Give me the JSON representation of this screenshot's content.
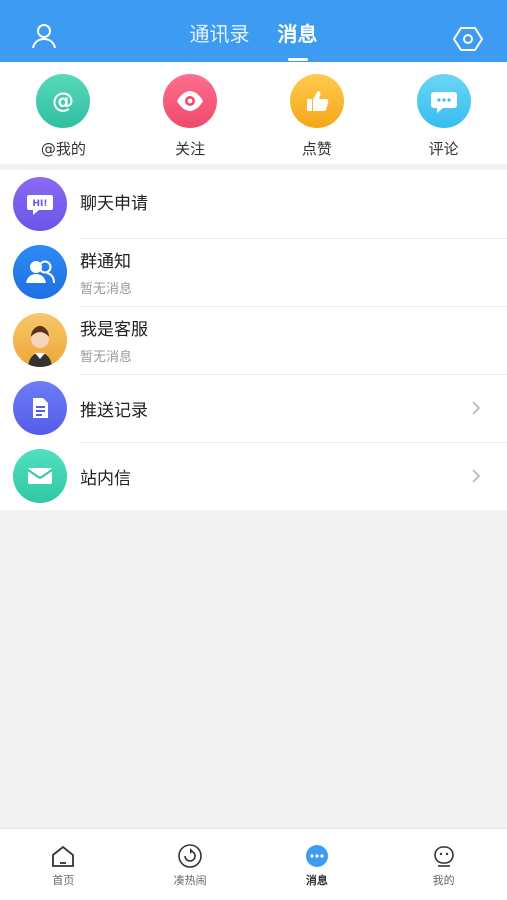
{
  "header": {
    "tabs": [
      {
        "label": "通讯录",
        "active": false
      },
      {
        "label": "消息",
        "active": true
      }
    ],
    "left_icon": "user-icon",
    "right_icon": "settings-hex-icon",
    "bg_color": "#3d9bf1"
  },
  "quick_actions": [
    {
      "label": "@我的",
      "icon": "at-icon",
      "color": "#3dcfae"
    },
    {
      "label": "关注",
      "icon": "eye-icon",
      "color": "#f25b7d"
    },
    {
      "label": "点赞",
      "icon": "thumbs-up-icon",
      "color": "#f5b22e"
    },
    {
      "label": "评论",
      "icon": "comment-icon",
      "color": "#45c7f2"
    }
  ],
  "messages": [
    {
      "title": "聊天申请",
      "subtitle": "",
      "icon": "hi-chat-bubble-icon",
      "chevron": false
    },
    {
      "title": "群通知",
      "subtitle": "暂无消息",
      "icon": "group-users-icon",
      "chevron": false
    },
    {
      "title": "我是客服",
      "subtitle": "暂无消息",
      "icon": "customer-service-avatar",
      "chevron": false
    },
    {
      "title": "推送记录",
      "subtitle": "",
      "icon": "document-icon",
      "chevron": true
    },
    {
      "title": "站内信",
      "subtitle": "",
      "icon": "mail-icon",
      "chevron": true
    }
  ],
  "bottom_nav": [
    {
      "label": "首页",
      "icon": "home-icon",
      "active": false
    },
    {
      "label": "凑热闹",
      "icon": "refresh-circle-icon",
      "active": false
    },
    {
      "label": "消息",
      "icon": "message-dots-icon",
      "active": true
    },
    {
      "label": "我的",
      "icon": "profile-face-icon",
      "active": false
    }
  ]
}
